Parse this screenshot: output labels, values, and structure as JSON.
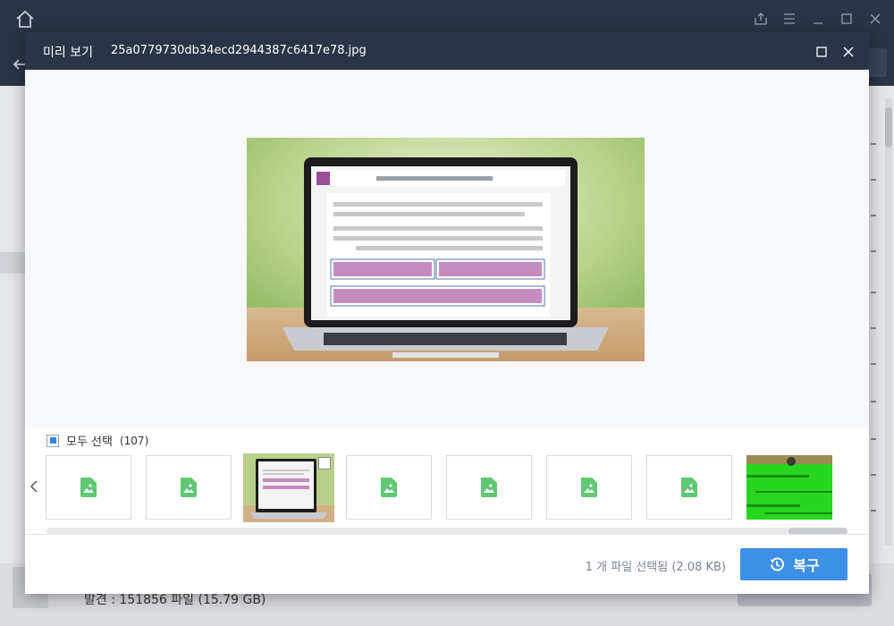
{
  "background": {
    "footer_text": "발견 : 151856 파일 (15.79 GB)"
  },
  "modal": {
    "title": "미리 보기",
    "filename": "25a0779730db34ecd2944387c6417e78.jpg"
  },
  "selection": {
    "select_all_label": "모두 선택",
    "select_all_count": "(107)",
    "checked": true
  },
  "thumbnails": [
    {
      "type": "placeholder",
      "icon": "image-icon"
    },
    {
      "type": "placeholder",
      "icon": "image-icon"
    },
    {
      "type": "photo",
      "selected": true
    },
    {
      "type": "placeholder",
      "icon": "image-icon"
    },
    {
      "type": "placeholder",
      "icon": "image-icon"
    },
    {
      "type": "placeholder",
      "icon": "image-icon"
    },
    {
      "type": "placeholder",
      "icon": "image-icon"
    },
    {
      "type": "photo"
    }
  ],
  "status": {
    "text": "1 개 파일 선택됨 (2.08 KB)"
  },
  "recover_button": {
    "label": "복구",
    "icon": "history-icon"
  },
  "colors": {
    "header": "#2b3346",
    "accent": "#3d8fe8",
    "image_icon": "#5ec972"
  }
}
